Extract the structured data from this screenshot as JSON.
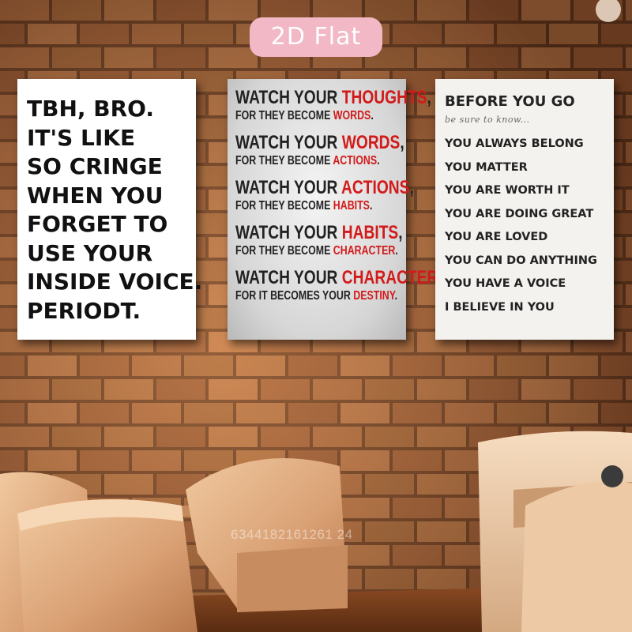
{
  "badge": {
    "label": "2D Flat"
  },
  "colors": {
    "brick": "#b46a3c",
    "mortar": "#6e3b1f",
    "accent_red": "#d21a1a",
    "badge_pink": "#f2b8c6",
    "chair": "#e4b48a"
  },
  "poster_left": {
    "lines": [
      "TBH, BRO.",
      "IT'S LIKE",
      "SO CRINGE",
      "WHEN YOU",
      "FORGET TO",
      "USE YOUR",
      "INSIDE VOICE.",
      "PERIODT."
    ]
  },
  "poster_middle": {
    "rows": [
      {
        "head_prefix": "WATCH YOUR ",
        "head_word": "THOUGHTS",
        "head_suffix": ",",
        "sub_prefix": "FOR THEY BECOME ",
        "sub_word": "WORDS",
        "sub_suffix": "."
      },
      {
        "head_prefix": "WATCH YOUR ",
        "head_word": "WORDS",
        "head_suffix": ",",
        "sub_prefix": "FOR THEY BECOME ",
        "sub_word": "ACTIONS",
        "sub_suffix": "."
      },
      {
        "head_prefix": "WATCH YOUR ",
        "head_word": "ACTIONS",
        "head_suffix": ",",
        "sub_prefix": "FOR THEY BECOME ",
        "sub_word": "HABITS",
        "sub_suffix": "."
      },
      {
        "head_prefix": "WATCH YOUR ",
        "head_word": "HABITS",
        "head_suffix": ",",
        "sub_prefix": "FOR THEY BECOME ",
        "sub_word": "CHARACTER",
        "sub_suffix": "."
      },
      {
        "head_prefix": "WATCH YOUR ",
        "head_word": "CHARACTER",
        "head_suffix": ",",
        "sub_prefix": "FOR IT BECOMES YOUR ",
        "sub_word": "DESTINY",
        "sub_suffix": "."
      }
    ]
  },
  "poster_right": {
    "title": "BEFORE YOU GO",
    "script": "be sure to know...",
    "items": [
      "YOU ALWAYS BELONG",
      "YOU MATTER",
      "YOU ARE WORTH IT",
      "YOU ARE DOING GREAT",
      "YOU ARE LOVED",
      "YOU CAN DO ANYTHING",
      "YOU HAVE A VOICE",
      "I BELIEVE IN YOU"
    ]
  },
  "watermark": {
    "text": "6344182161261 24"
  }
}
